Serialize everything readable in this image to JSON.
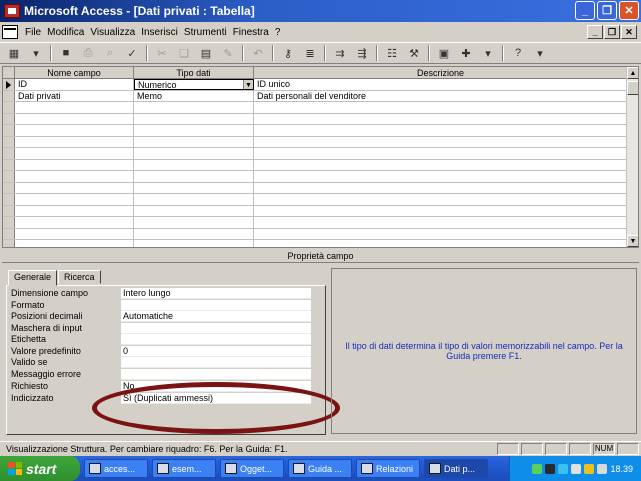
{
  "window": {
    "title": "Microsoft Access - [Dati privati : Tabella]"
  },
  "menu": {
    "items": [
      "File",
      "Modifica",
      "Visualizza",
      "Inserisci",
      "Strumenti",
      "Finestra",
      "?"
    ]
  },
  "grid": {
    "headers": [
      "Nome campo",
      "Tipo dati",
      "Descrizione"
    ],
    "rows": [
      {
        "name": "ID",
        "type": "Numerico",
        "description": "ID unico"
      },
      {
        "name": "Dati privati",
        "type": "Memo",
        "description": "Dati personali del venditore"
      }
    ]
  },
  "properties": {
    "header": "Proprietà campo",
    "tabs": [
      "Generale",
      "Ricerca"
    ],
    "rows": [
      {
        "label": "Dimensione campo",
        "value": "Intero lungo"
      },
      {
        "label": "Formato",
        "value": ""
      },
      {
        "label": "Posizioni decimali",
        "value": "Automatiche"
      },
      {
        "label": "Maschera di input",
        "value": ""
      },
      {
        "label": "Etichetta",
        "value": ""
      },
      {
        "label": "Valore predefinito",
        "value": "0"
      },
      {
        "label": "Valido se",
        "value": ""
      },
      {
        "label": "Messaggio errore",
        "value": ""
      },
      {
        "label": "Richiesto",
        "value": "No"
      },
      {
        "label": "Indicizzato",
        "value": "Sì (Duplicati ammessi)"
      }
    ],
    "help_text": "Il tipo di dati determina il tipo di valori memorizzabili nel campo. Per la Guida premere F1."
  },
  "status": {
    "text": "Visualizzazione Struttura. Per cambiare riquadro: F6. Per la Guida: F1.",
    "num": "NUM"
  },
  "taskbar": {
    "start": "start",
    "tasks": [
      "acces...",
      "esem...",
      "Ogget...",
      "Guida ...",
      "Relazioni",
      "Dati p..."
    ],
    "clock": "18.39"
  },
  "colors": {
    "titlebar": "#0a246a",
    "help_text": "#1a2bb8",
    "annotation": "#7a1414",
    "taskbar": "#245edb",
    "start": "#3fa63a"
  }
}
